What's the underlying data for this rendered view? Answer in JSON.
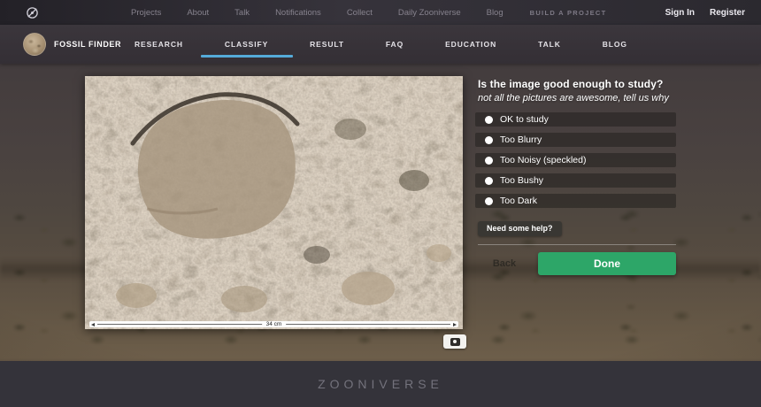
{
  "colors": {
    "accent_blue": "#55abd9",
    "done_green": "#2da668"
  },
  "topnav": {
    "logo_icon": "zooniverse-logo",
    "links": [
      "Projects",
      "About",
      "Talk",
      "Notifications",
      "Collect",
      "Daily Zooniverse",
      "Blog"
    ],
    "build_link": "BUILD A PROJECT",
    "sign_in": "Sign In",
    "register": "Register"
  },
  "project_nav": {
    "avatar_icon": "fossil-project-avatar",
    "project_name": "FOSSIL FINDER",
    "tabs": [
      {
        "label": "RESEARCH",
        "active": false
      },
      {
        "label": "CLASSIFY",
        "active": true
      },
      {
        "label": "RESULT",
        "active": false
      },
      {
        "label": "FAQ",
        "active": false
      },
      {
        "label": "EDUCATION",
        "active": false
      },
      {
        "label": "TALK",
        "active": false
      },
      {
        "label": "BLOG",
        "active": false
      }
    ]
  },
  "subject": {
    "scale_label": "34 cm",
    "metadata_icon": "camera-icon"
  },
  "task": {
    "question": "Is the image good enough to study?",
    "hint": "not all the pictures are awesome, tell us why",
    "options": [
      "OK to study",
      "Too Blurry",
      "Too Noisy (speckled)",
      "Too Bushy",
      "Too Dark"
    ],
    "help_button": "Need some help?",
    "back_button": "Back",
    "done_button": "Done"
  },
  "footer": {
    "brand": "ZOONIVERSE"
  }
}
